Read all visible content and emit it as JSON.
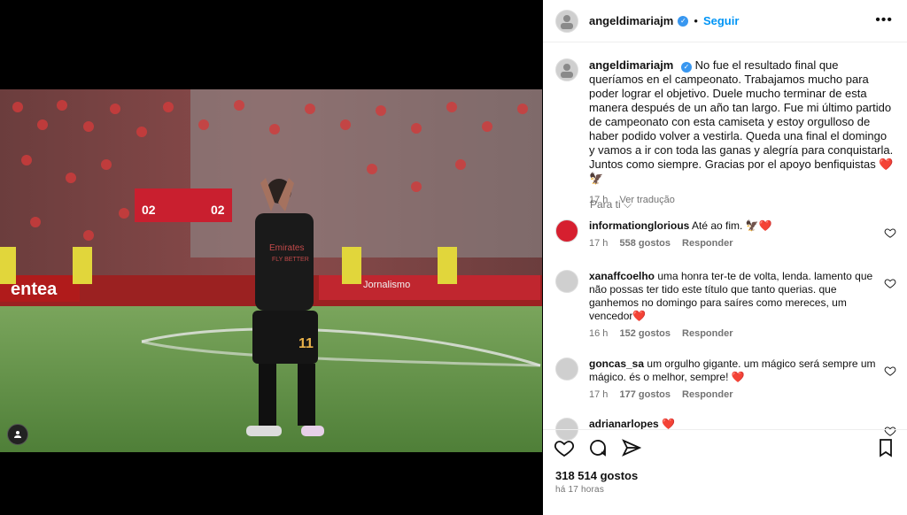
{
  "post": {
    "username": "angeldimariajm",
    "follow_label": "Seguir",
    "more_label": "•••",
    "caption": "No fue el resultado final que queríamos en el campeonato. Trabajamos mucho para poder lograr el objetivo. Duele mucho terminar de esta manera después de un año tan largo. Fue mi último partido de campeonato con esta camiseta y estoy orgulloso de haber podido volver a vestirla. Queda una final el domingo y vamos a ir con toda las ganas y alegría para conquistarla. Juntos como siempre. Gracias por el apoyo benfiquistas ❤️🦅",
    "caption_time": "17 h",
    "translate_label": "Ver tradução",
    "for_you_label": "Para ti",
    "likes": "318 514 gostos",
    "posted_ago": "há 17 horas"
  },
  "comments": [
    {
      "user": "informationglorious",
      "text": "Até ao fim. 🦅❤️",
      "time": "17 h",
      "likes": "558 gostos",
      "reply": "Responder"
    },
    {
      "user": "xanaffcoelho",
      "text": "uma honra ter-te de volta, lenda. lamento que não possas ter tido este título que tanto querias. que ganhemos no domingo para saíres como mereces, um vencedor❤️",
      "time": "16 h",
      "likes": "152 gostos",
      "reply": "Responder"
    },
    {
      "user": "goncas_sa",
      "text": "um orgulho gigante. um mágico será sempre um mágico. és o melhor, sempre! ❤️",
      "time": "17 h",
      "likes": "177 gostos",
      "reply": "Responder"
    },
    {
      "user": "adrianarlopes",
      "text": "❤️",
      "time": "",
      "likes": "",
      "reply": ""
    }
  ],
  "photo": {
    "banner_left": "entea",
    "banner_right": "Jornalismo",
    "sponsor": "Emirates FLY BETTER",
    "shirt_number": "11",
    "scoreboard": "02 02"
  },
  "colors": {
    "accent": "#0095f6",
    "verified": "#3897f0",
    "heart": "#ed4956"
  }
}
